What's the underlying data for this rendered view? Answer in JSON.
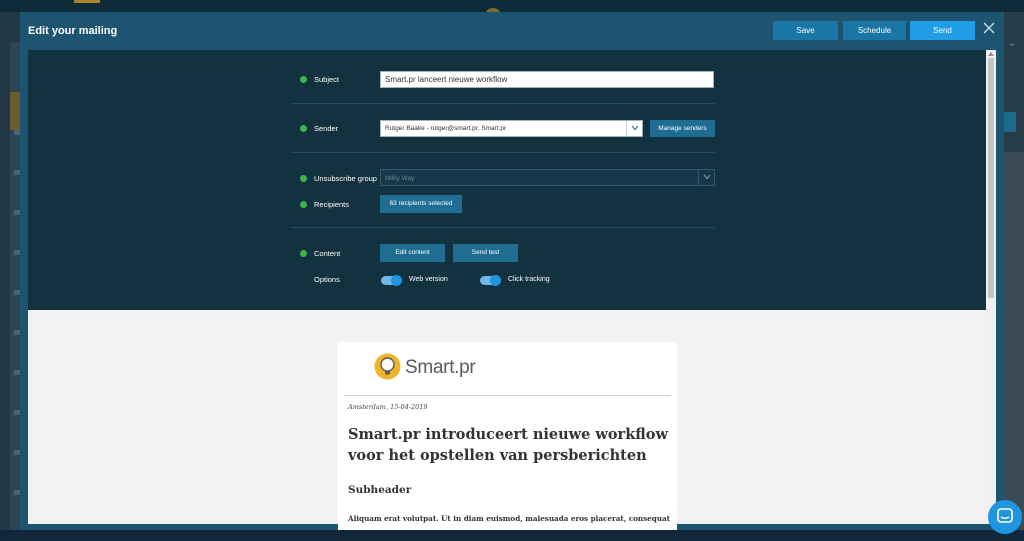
{
  "modal": {
    "title": "Edit your mailing",
    "buttons": {
      "save": "Save",
      "schedule": "Schedule",
      "send": "Send"
    }
  },
  "form": {
    "subject": {
      "label": "Subject",
      "value": "Smart.pr lanceert nieuwe workflow"
    },
    "sender": {
      "label": "Sender",
      "value": "Rutger Baake - rutger@smart.pr, Smart.pr",
      "manage_label": "Manage senders"
    },
    "unsubscribe": {
      "label": "Unsubscribe group",
      "placeholder": "Milky Way"
    },
    "recipients": {
      "label": "Recipients",
      "button_label": "63 recipients selected"
    },
    "content": {
      "label": "Content",
      "edit_label": "Edit content",
      "test_label": "Send test"
    },
    "options": {
      "label": "Options",
      "web_version": "Web version",
      "click_tracking": "Click tracking"
    }
  },
  "preview": {
    "brand": "Smart.pr",
    "date": "Amsterdam, 15-04-2019",
    "title": "Smart.pr introduceert nieuwe workflow voor het opstellen van persberichten",
    "subheader": "Subheader",
    "body": "Aliquam erat volutpat. Ut in diam euismod, malesuada eros placerat, consequat"
  },
  "colors": {
    "accent": "#1f9ee6",
    "button": "#1a76a6",
    "status_ok": "#3bb54a",
    "panel": "#12323f"
  }
}
